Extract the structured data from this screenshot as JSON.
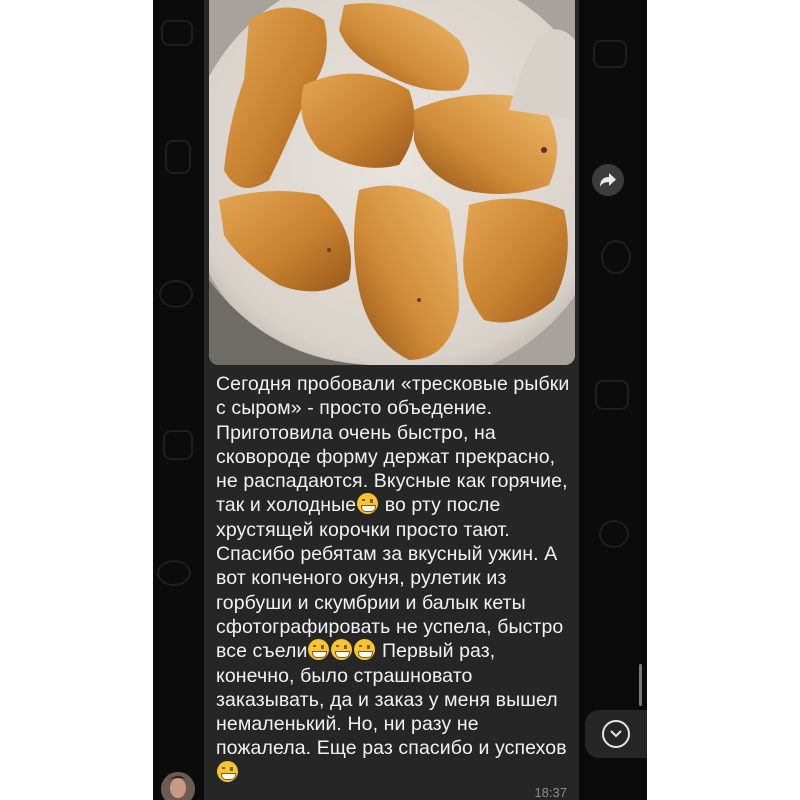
{
  "message": {
    "segments": [
      "Сегодня пробовали «тресковые рыбки с сыром» - просто объедение. Приготовила очень быстро, на сковороде форму держат прекрасно, не распадаются. Вкусные как горячие, так и холодные",
      " во рту после хрустящей корочки просто тают. Спасибо ребятам за вкусный ужин. А вот копченого окуня, рулетик из горбуши и скумбрии и балык кеты сфотографировать не успела, быстро все съели",
      " Первый раз, конечно, было страшновато заказывать, да и заказ у меня вышел немаленький. Но, ни разу не пожалела. Еще раз спасибо и успехов"
    ],
    "time": "18:37",
    "emoji": {
      "grin": "grinning-face-emoji",
      "laugh": "tears-of-joy-emoji"
    }
  },
  "photo": {
    "subject": "fried-fish-nuggets-photo"
  },
  "icons": {
    "forward": "forward-icon",
    "scroll_down": "chevron-down-icon"
  },
  "colors": {
    "background": "#0b0b0b",
    "bubble": "#262626",
    "text": "#f2f2f2",
    "time": "#8d8d8d"
  }
}
